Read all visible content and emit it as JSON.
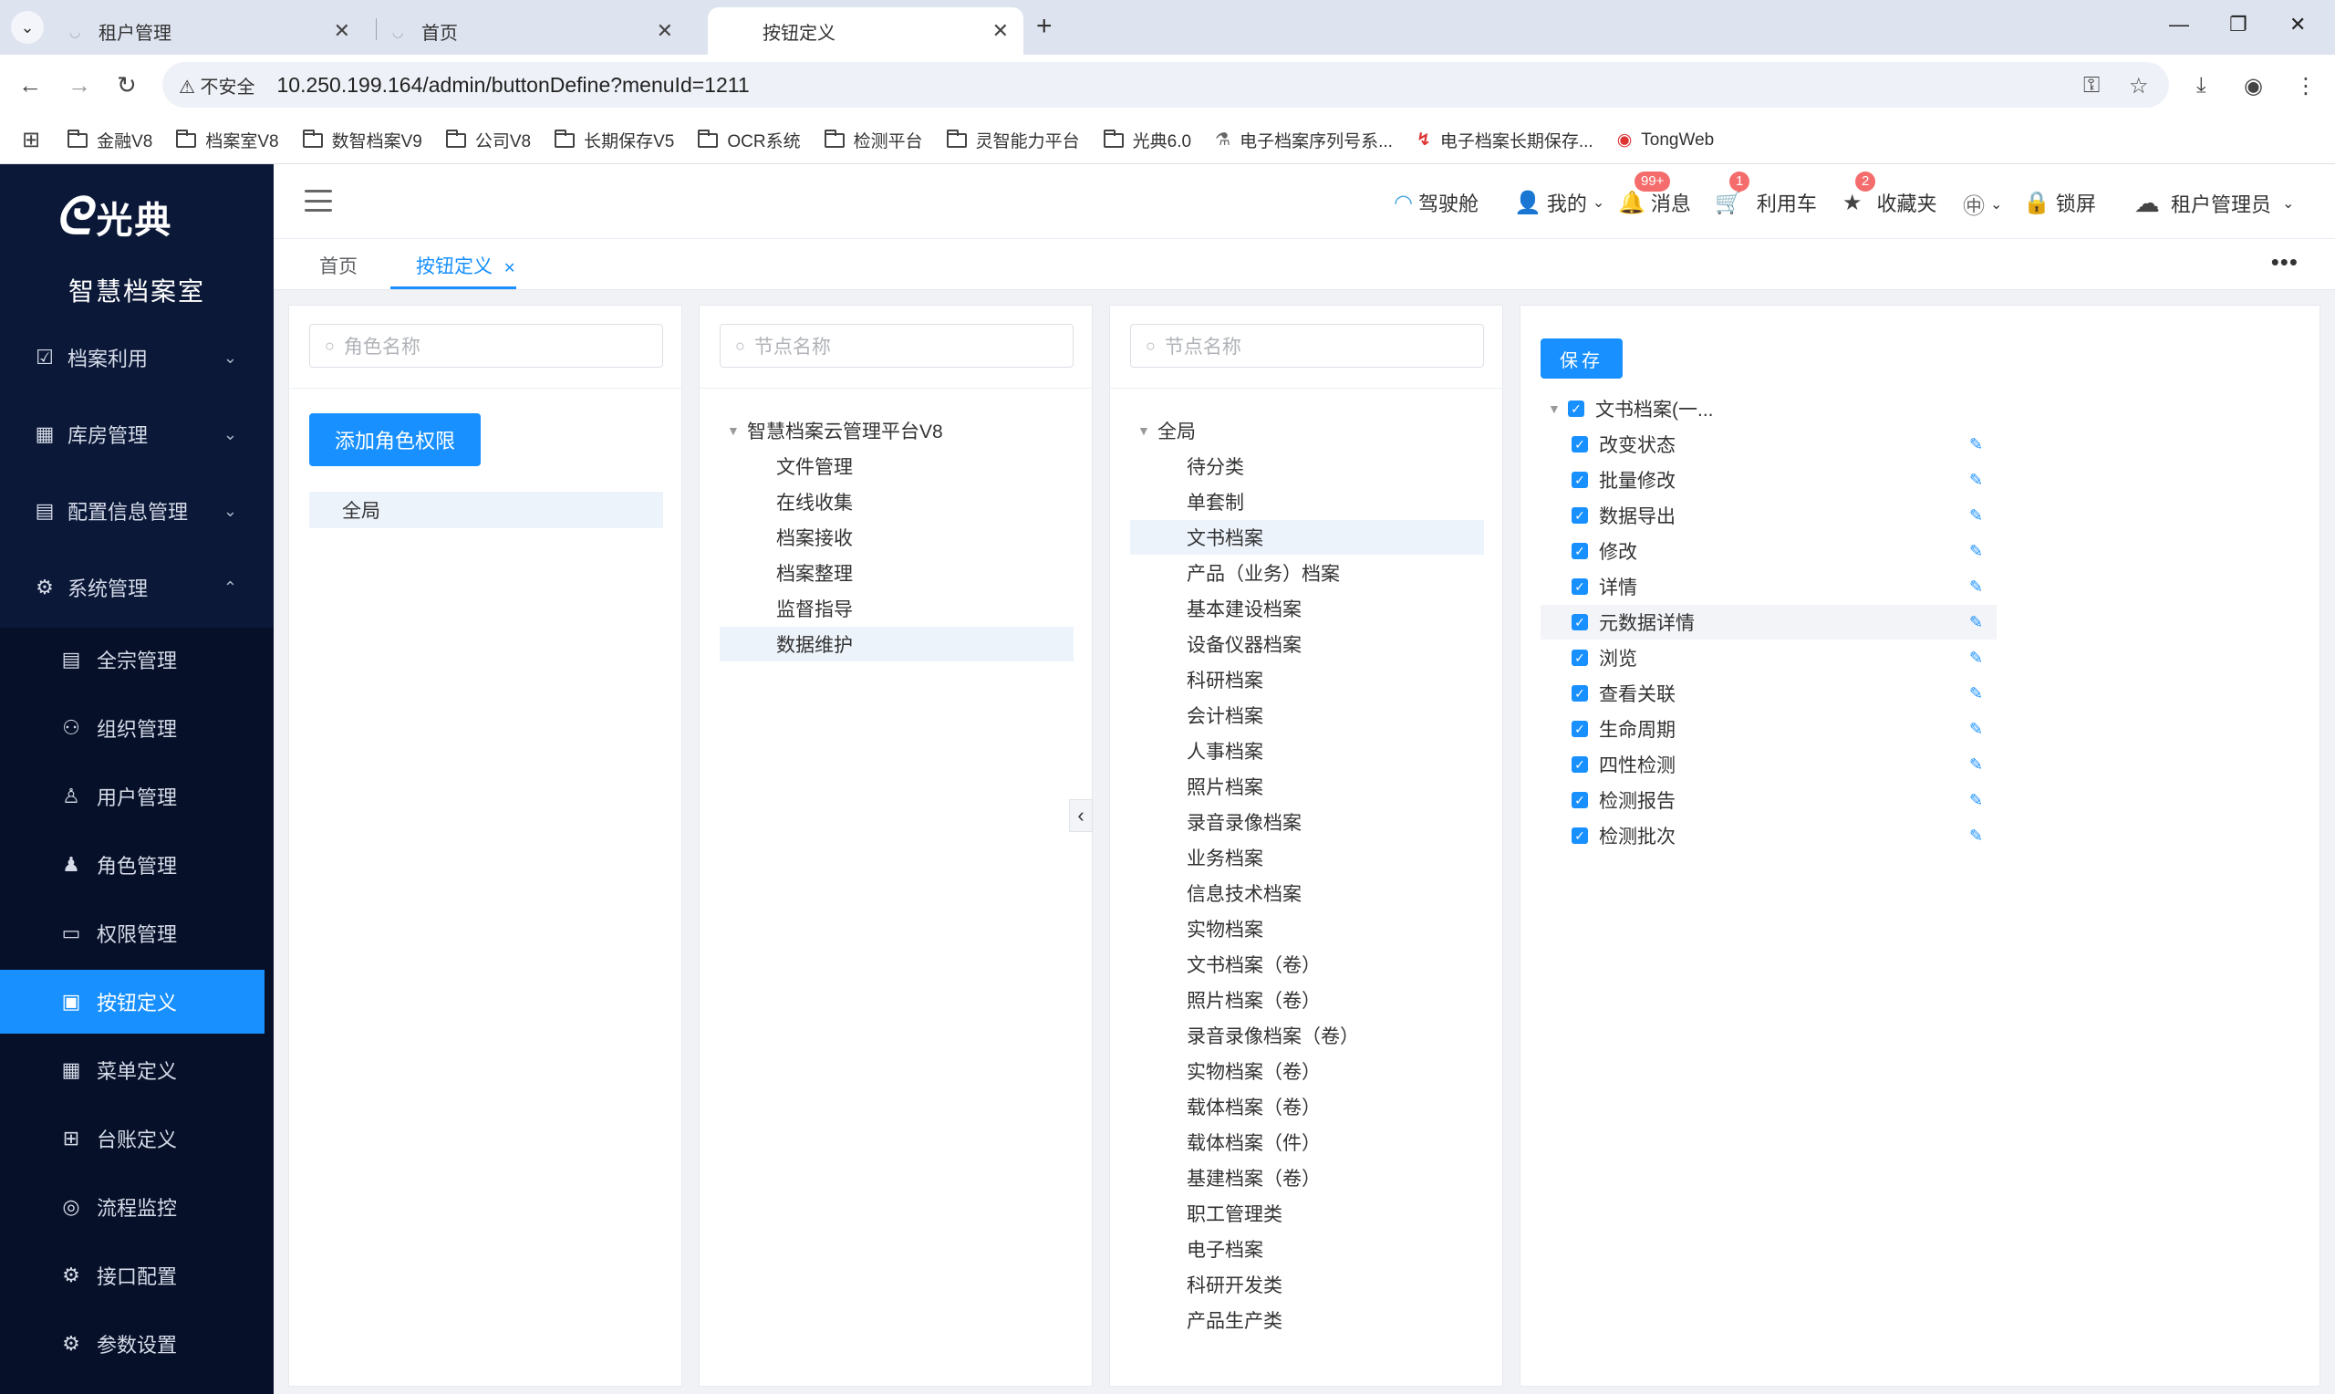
{
  "browser": {
    "tabs": [
      {
        "title": "租户管理"
      },
      {
        "title": "首页"
      },
      {
        "title": "按钮定义"
      }
    ],
    "security_label": "不安全",
    "url": "10.250.199.164/admin/buttonDefine?menuId=1211",
    "bookmarks": [
      "金融V8",
      "档案室V8",
      "数智档案V9",
      "公司V8",
      "长期保存V5",
      "OCR系统",
      "检测平台",
      "灵智能力平台",
      "光典6.0",
      "电子档案序列号系...",
      "电子档案长期保存...",
      "TongWeb"
    ]
  },
  "sidebar": {
    "logo_text": "光典",
    "subtitle": "智慧档案室",
    "groups": [
      {
        "label": "档案利用",
        "icon": "checkbox-icon"
      },
      {
        "label": "库房管理",
        "icon": "building-icon"
      },
      {
        "label": "配置信息管理",
        "icon": "clipboard-icon"
      },
      {
        "label": "系统管理",
        "icon": "gear-icon"
      }
    ],
    "items": [
      {
        "label": "全宗管理",
        "icon": "document-icon"
      },
      {
        "label": "组织管理",
        "icon": "org-icon"
      },
      {
        "label": "用户管理",
        "icon": "user-icon"
      },
      {
        "label": "角色管理",
        "icon": "person-icon"
      },
      {
        "label": "权限管理",
        "icon": "folder-icon"
      },
      {
        "label": "按钮定义",
        "icon": "button-icon"
      },
      {
        "label": "菜单定义",
        "icon": "grid-icon"
      },
      {
        "label": "台账定义",
        "icon": "tiles-icon"
      },
      {
        "label": "流程监控",
        "icon": "eye-icon"
      },
      {
        "label": "接口配置",
        "icon": "gear-icon"
      },
      {
        "label": "参数设置",
        "icon": "settings-icon"
      }
    ]
  },
  "header": {
    "cockpit": "驾驶舱",
    "mine": "我的",
    "messages": "消息",
    "messages_badge": "99+",
    "cart": "利用车",
    "cart_badge": "1",
    "favorites": "收藏夹",
    "favorites_badge": "2",
    "lock": "锁屏",
    "user": "租户管理员"
  },
  "tags": {
    "home": "首页",
    "current": "按钮定义"
  },
  "roles_panel": {
    "search_placeholder": "角色名称",
    "add_button": "添加角色权限",
    "roles": [
      "全局"
    ]
  },
  "nodes_panel": {
    "search_placeholder": "节点名称",
    "root": "智慧档案云管理平台V8",
    "children": [
      "文件管理",
      "在线收集",
      "档案接收",
      "档案整理",
      "监督指导",
      "数据维护"
    ]
  },
  "categories_panel": {
    "search_placeholder": "节点名称",
    "root": "全局",
    "children": [
      "待分类",
      "单套制",
      "文书档案",
      "产品（业务）档案",
      "基本建设档案",
      "设备仪器档案",
      "科研档案",
      "会计档案",
      "人事档案",
      "照片档案",
      "录音录像档案",
      "业务档案",
      "信息技术档案",
      "实物档案",
      "文书档案（卷）",
      "照片档案（卷）",
      "录音录像档案（卷）",
      "实物档案（卷）",
      "载体档案（卷）",
      "载体档案（件）",
      "基建档案（卷）",
      "职工管理类",
      "电子档案",
      "科研开发类",
      "产品生产类"
    ]
  },
  "buttons_panel": {
    "save_label": "保存",
    "root": "文书档案(一...",
    "buttons": [
      "改变状态",
      "批量修改",
      "数据导出",
      "修改",
      "详情",
      "元数据详情",
      "浏览",
      "查看关联",
      "生命周期",
      "四性检测",
      "检测报告",
      "检测批次"
    ]
  }
}
